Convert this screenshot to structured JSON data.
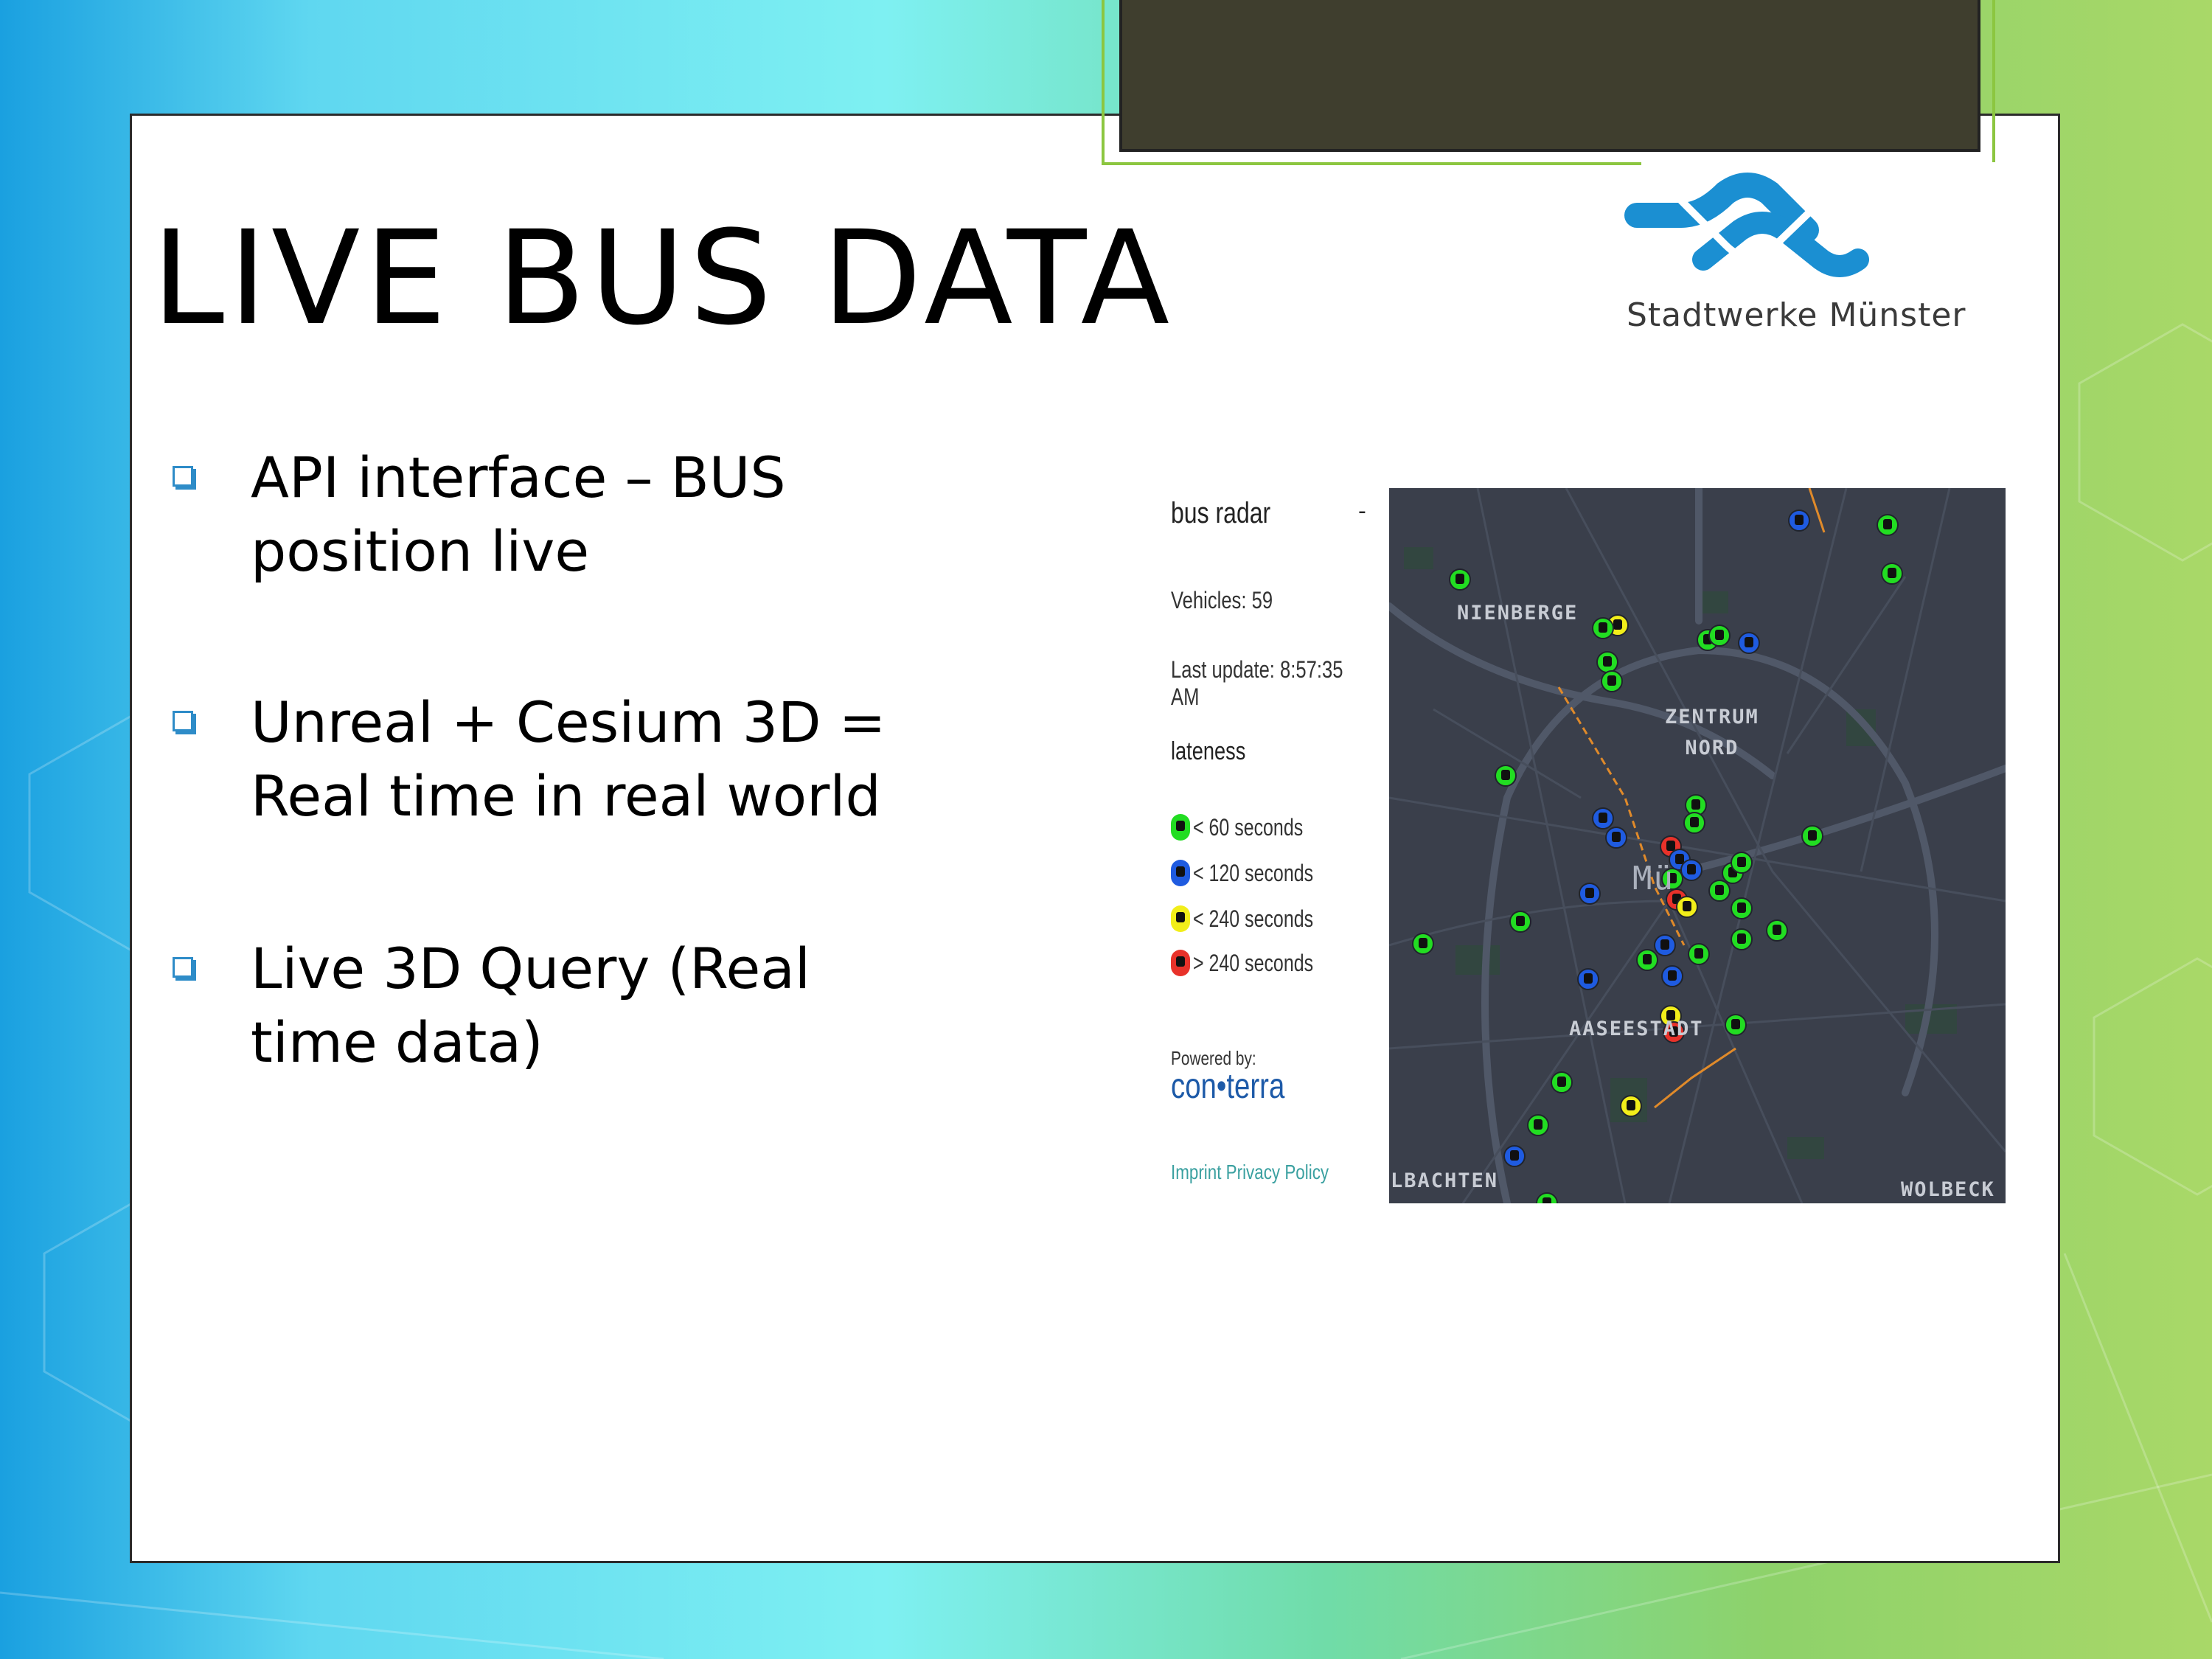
{
  "slide": {
    "title": "LIVE BUS DATA",
    "logo_text": "Stadtwerke Münster",
    "bullets": [
      {
        "text": "API interface – BUS\nposition live"
      },
      {
        "text": "Unreal + Cesium 3D =\nReal time in real world"
      },
      {
        "text": "Live 3D Query (Real\ntime data)"
      }
    ]
  },
  "bus_radar": {
    "title": "bus radar",
    "dash": "-",
    "vehicles": "Vehicles: 59",
    "last_update": "Last update: 8:57:35 AM",
    "lateness_heading": "lateness",
    "legend": [
      {
        "label": "< 60 seconds",
        "color": "#22dd22"
      },
      {
        "label": "< 120 seconds",
        "color": "#1f5be0"
      },
      {
        "label": "< 240 seconds",
        "color": "#f2ee1a"
      },
      {
        "label": "> 240 seconds",
        "color": "#e8322a"
      }
    ],
    "powered_by": "Powered by:",
    "powered_brand": "con•terra",
    "links": "Imprint Privacy Policy"
  },
  "map": {
    "labels": {
      "nienberge": "NIENBERGE",
      "zentrum": "ZENTRUM\nNORD",
      "center": "Mü",
      "aaseestadt": "AASEESTADT",
      "albachten": "LBACHTEN",
      "wolbeck": "WOLBECK"
    },
    "colors": {
      "background": "#3a3f4b",
      "green": "#22dd22",
      "blue": "#1f5be0",
      "yellow": "#f2ee1a",
      "red": "#e8322a"
    }
  }
}
